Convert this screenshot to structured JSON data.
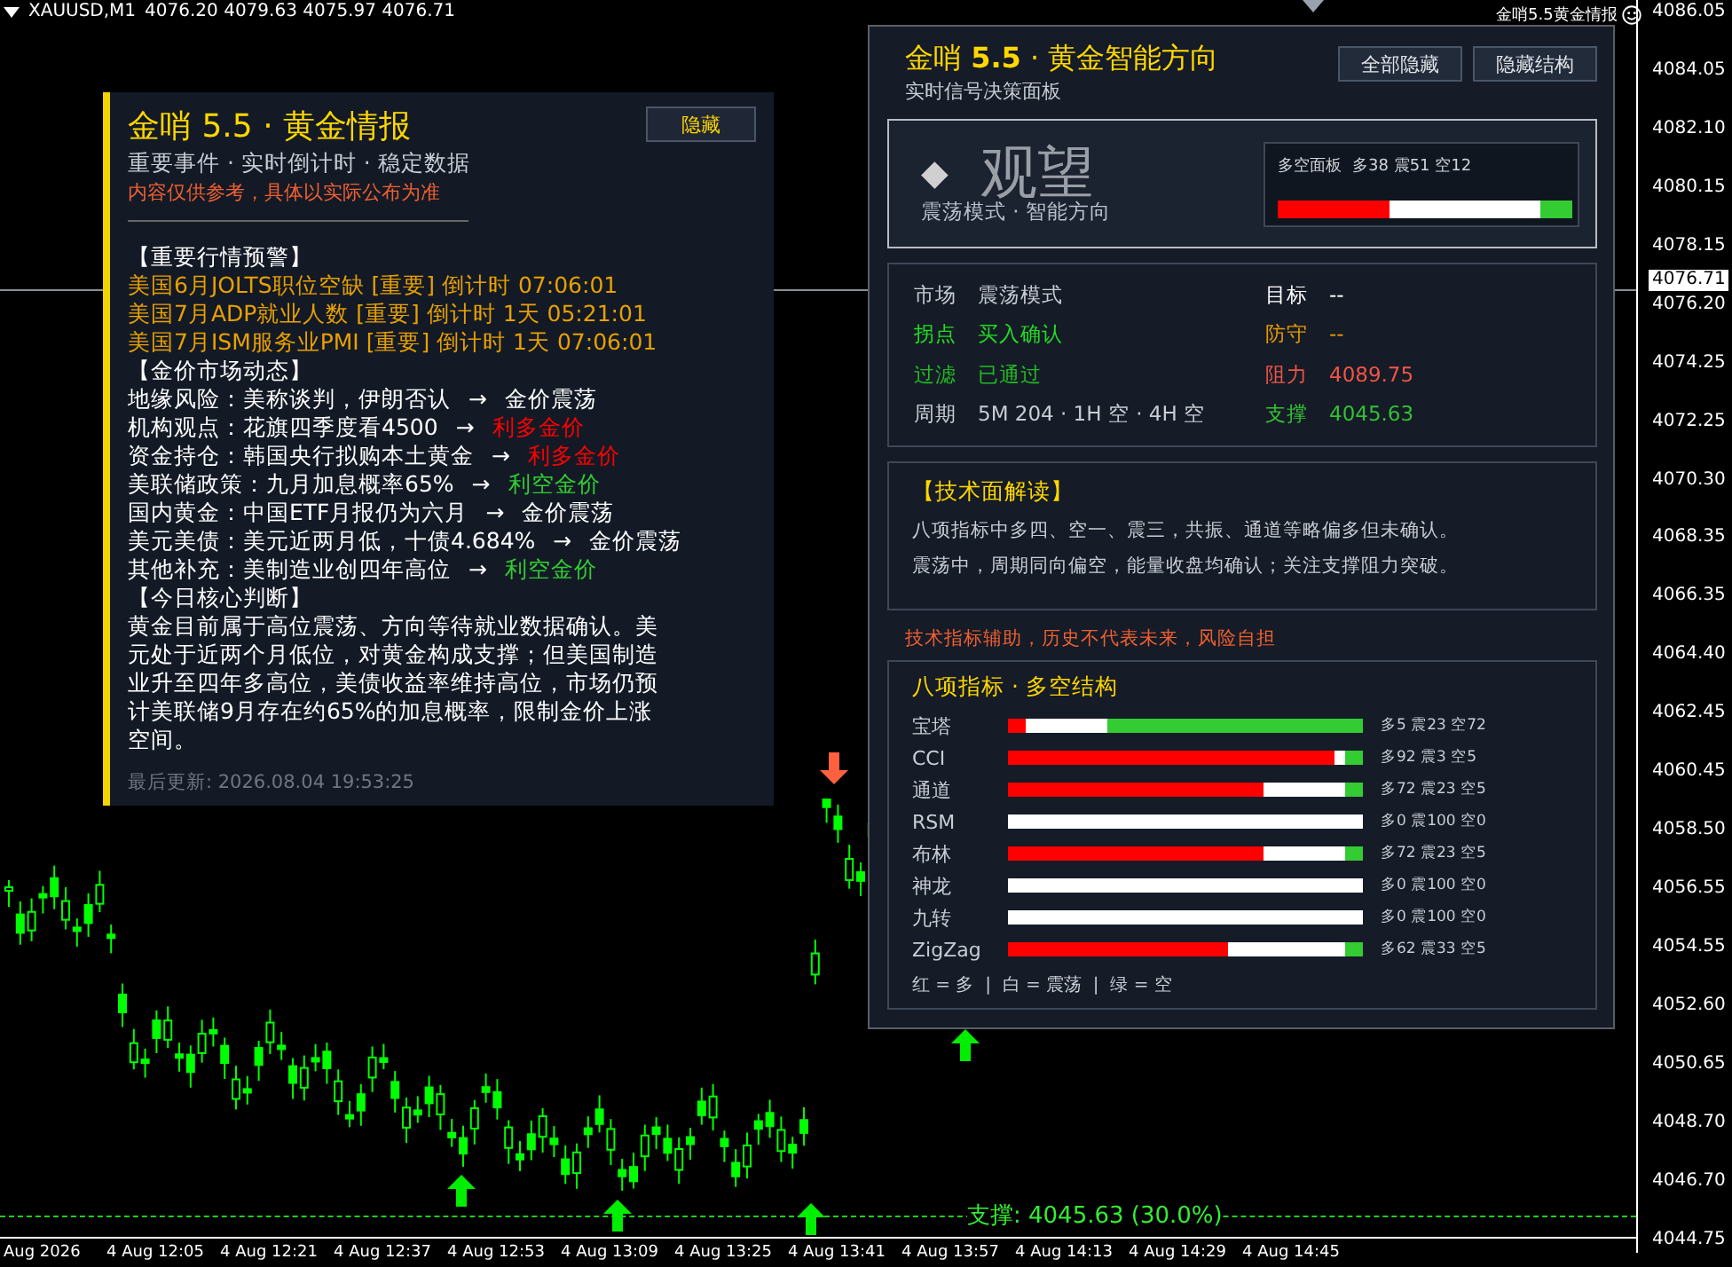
{
  "top_bar": {
    "symbol": "XAUUSD,M1",
    "quote": "4076.20 4079.63 4075.97 4076.71",
    "indicator_label": "金哨5.5黄金情报"
  },
  "price_axis": {
    "ticks": [
      "4086.05",
      "4084.05",
      "4082.10",
      "4080.15",
      "4078.15",
      "4076.20",
      "4074.25",
      "4072.25",
      "4070.30",
      "4068.35",
      "4066.35",
      "4064.40",
      "4062.45",
      "4060.45",
      "4058.50",
      "4056.55",
      "4054.55",
      "4052.60",
      "4050.65",
      "4048.70",
      "4046.70",
      "4044.75"
    ],
    "current_price": "4076.71"
  },
  "time_axis": [
    "Aug 2026",
    "4 Aug 12:05",
    "4 Aug 12:21",
    "4 Aug 12:37",
    "4 Aug 12:53",
    "4 Aug 13:09",
    "4 Aug 13:25",
    "4 Aug 13:41",
    "4 Aug 13:57",
    "4 Aug 14:13",
    "4 Aug 14:29",
    "4 Aug 14:45"
  ],
  "support_line": {
    "label": "支撑: 4045.63 (30.0%)"
  },
  "news_panel": {
    "title": "金哨 5.5 · 黄金情报",
    "subtitle": "重要事件 · 实时倒计时 · 稳定数据",
    "disclaimer": "内容仅供参考，具体以实际公布为准",
    "hide_button": "隐藏",
    "lines": [
      {
        "kind": "heading",
        "text": "【重要行情预警】"
      },
      {
        "kind": "event",
        "text": "美国6月JOLTS职位空缺 [重要] 倒计时 07:06:01"
      },
      {
        "kind": "event",
        "text": "美国7月ADP就业人数 [重要] 倒计时 1天 05:21:01"
      },
      {
        "kind": "event",
        "text": "美国7月ISM服务业PMI [重要] 倒计时 1天 07:06:01"
      },
      {
        "kind": "heading",
        "text": "【金价市场动态】"
      },
      {
        "kind": "factor",
        "text": "地缘风险：美称谈判，伊朗否认",
        "arrow": "→",
        "verdict": "金价震荡",
        "color": "#ffffff"
      },
      {
        "kind": "factor",
        "text": "机构观点：花旗四季度看4500",
        "arrow": "→",
        "verdict": "利多金价",
        "color": "#ff0000"
      },
      {
        "kind": "factor",
        "text": "资金持仓：韩国央行拟购本土黄金",
        "arrow": "→",
        "verdict": "利多金价",
        "color": "#ff0000"
      },
      {
        "kind": "factor",
        "text": "美联储政策：九月加息概率65%",
        "arrow": "→",
        "verdict": "利空金价",
        "color": "#33cc33"
      },
      {
        "kind": "factor",
        "text": "国内黄金：中国ETF月报仍为六月",
        "arrow": "→",
        "verdict": "金价震荡",
        "color": "#ffffff"
      },
      {
        "kind": "factor",
        "text": "美元美债：美元近两月低，十债4.684%",
        "arrow": "→",
        "verdict": "金价震荡",
        "color": "#ffffff"
      },
      {
        "kind": "factor",
        "text": "其他补充：美制造业创四年高位",
        "arrow": "→",
        "verdict": "利空金价",
        "color": "#33cc33"
      },
      {
        "kind": "heading",
        "text": "【今日核心判断】"
      },
      {
        "kind": "paragraph",
        "text": "黄金目前属于高位震荡、方向等待就业数据确认。美元处于近两个月低位，对黄金构成支撑；但美国制造业升至四年多高位，美债收益率维持高位，市场仍预计美联储9月存在约65%的加息概率，限制金价上涨空间。"
      }
    ],
    "updated": "最后更新: 2026.08.04 19:53:25"
  },
  "signal_panel": {
    "title": "金哨 **5.5** · 黄金智能方向",
    "subtitle": "实时信号决策面板",
    "buttons": [
      "全部隐藏",
      "隐藏结构"
    ],
    "signal": {
      "icon": "◆",
      "label": "观望",
      "mode": "震荡模式 · 智能方向"
    },
    "balance": {
      "title": "多空面板",
      "reading": "多38 震51 空12",
      "bull": {
        "level": 0.38
      },
      "bear": {
        "level": 0.11
      }
    },
    "info_left": [
      {
        "label": "市场",
        "value": "震荡模式",
        "color": "#c8ccd4"
      },
      {
        "label": "拐点",
        "value": "买入确认",
        "color": "#22dd22"
      },
      {
        "label": "过滤",
        "value": "已通过",
        "color": "#22bb22"
      },
      {
        "label": "周期",
        "value": "5M 204 · 1H 空 · 4H 空",
        "color": "#c8ccd4"
      }
    ],
    "info_right": [
      {
        "label": "目标",
        "value": "--",
        "color": "#ffffff"
      },
      {
        "label": "防守",
        "value": "--",
        "color": "#e69a00"
      },
      {
        "label": "阻力",
        "value": "4089.75",
        "color": "#f05545"
      },
      {
        "label": "支撑",
        "value": "4045.63",
        "color": "#33c033"
      }
    ],
    "analysis": {
      "title": "【技术面解读】",
      "lines": [
        "八项指标中多四、空一、震三，共振、通道等略偏多但未确认。",
        "震荡中，周期同向偏空，能量收盘均确认；关注支撑阻力突破。"
      ]
    },
    "risk_note": "技术指标辅助，历史不代表未来，风险自担",
    "indicators": {
      "title": "八项指标 · 多空结构",
      "rows": [
        {
          "name": "宝塔",
          "reading": "多5 震23 空72",
          "bull": {
            "level": 0.05
          },
          "bear": {
            "level": 0.72
          }
        },
        {
          "name": "CCI",
          "reading": "多92 震3 空5",
          "bull": {
            "level": 0.92
          },
          "bear": {
            "level": 0.05
          }
        },
        {
          "name": "通道",
          "reading": "多72 震23 空5",
          "bull": {
            "level": 0.72
          },
          "bear": {
            "level": 0.05
          }
        },
        {
          "name": "RSM",
          "reading": "多0 震100 空0"
        },
        {
          "name": "布林",
          "reading": "多72 震23 空5",
          "bull": {
            "level": 0.72
          },
          "bear": {
            "level": 0.05
          }
        },
        {
          "name": "神龙",
          "reading": "多0 震100 空0"
        },
        {
          "name": "九转",
          "reading": "多0 震100 空0"
        },
        {
          "name": "ZigZag",
          "reading": "多62 震33 空5",
          "bull": {
            "level": 0.62
          },
          "bear": {
            "level": 0.05
          }
        }
      ],
      "legend": "红 = 多  |  白 = 震荡  |  绿 = 空"
    }
  }
}
